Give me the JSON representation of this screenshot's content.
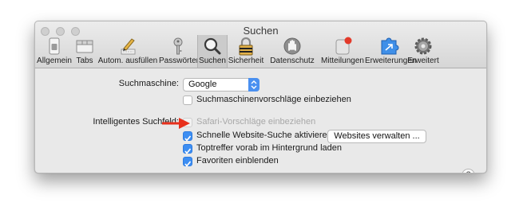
{
  "window": {
    "title": "Suchen"
  },
  "toolbar": {
    "items": [
      {
        "label": "Allgemein",
        "icon": "switch-icon"
      },
      {
        "label": "Tabs",
        "icon": "tabs-icon"
      },
      {
        "label": "Autom. ausfüllen",
        "icon": "pencil-icon"
      },
      {
        "label": "Passwörter",
        "icon": "key-icon"
      },
      {
        "label": "Suchen",
        "icon": "magnifier-icon",
        "selected": true
      },
      {
        "label": "Sicherheit",
        "icon": "lock-icon"
      },
      {
        "label": "Datenschutz",
        "icon": "hand-icon"
      },
      {
        "label": "Mitteilungen",
        "icon": "notification-icon"
      },
      {
        "label": "Erweiterungen",
        "icon": "puzzle-icon"
      },
      {
        "label": "Erweitert",
        "icon": "gear-icon"
      }
    ]
  },
  "search": {
    "engine_label": "Suchmaschine:",
    "engine_value": "Google",
    "suggestions_label": "Suchmaschinenvorschläge einbeziehen",
    "suggestions_checked": false
  },
  "smart": {
    "label": "Intelligentes Suchfeld:",
    "safari_suggestions": "Safari-Vorschläge einbeziehen",
    "quick_search": "Schnelle Website-Suche aktivieren",
    "manage_sites": "Websites verwalten ...",
    "preload": "Toptreffer vorab im Hintergrund laden",
    "favorites": "Favoriten einblenden"
  },
  "help": {
    "label": "?"
  },
  "colors": {
    "accent": "#3d8ef2",
    "arrow": "#e8301c"
  }
}
